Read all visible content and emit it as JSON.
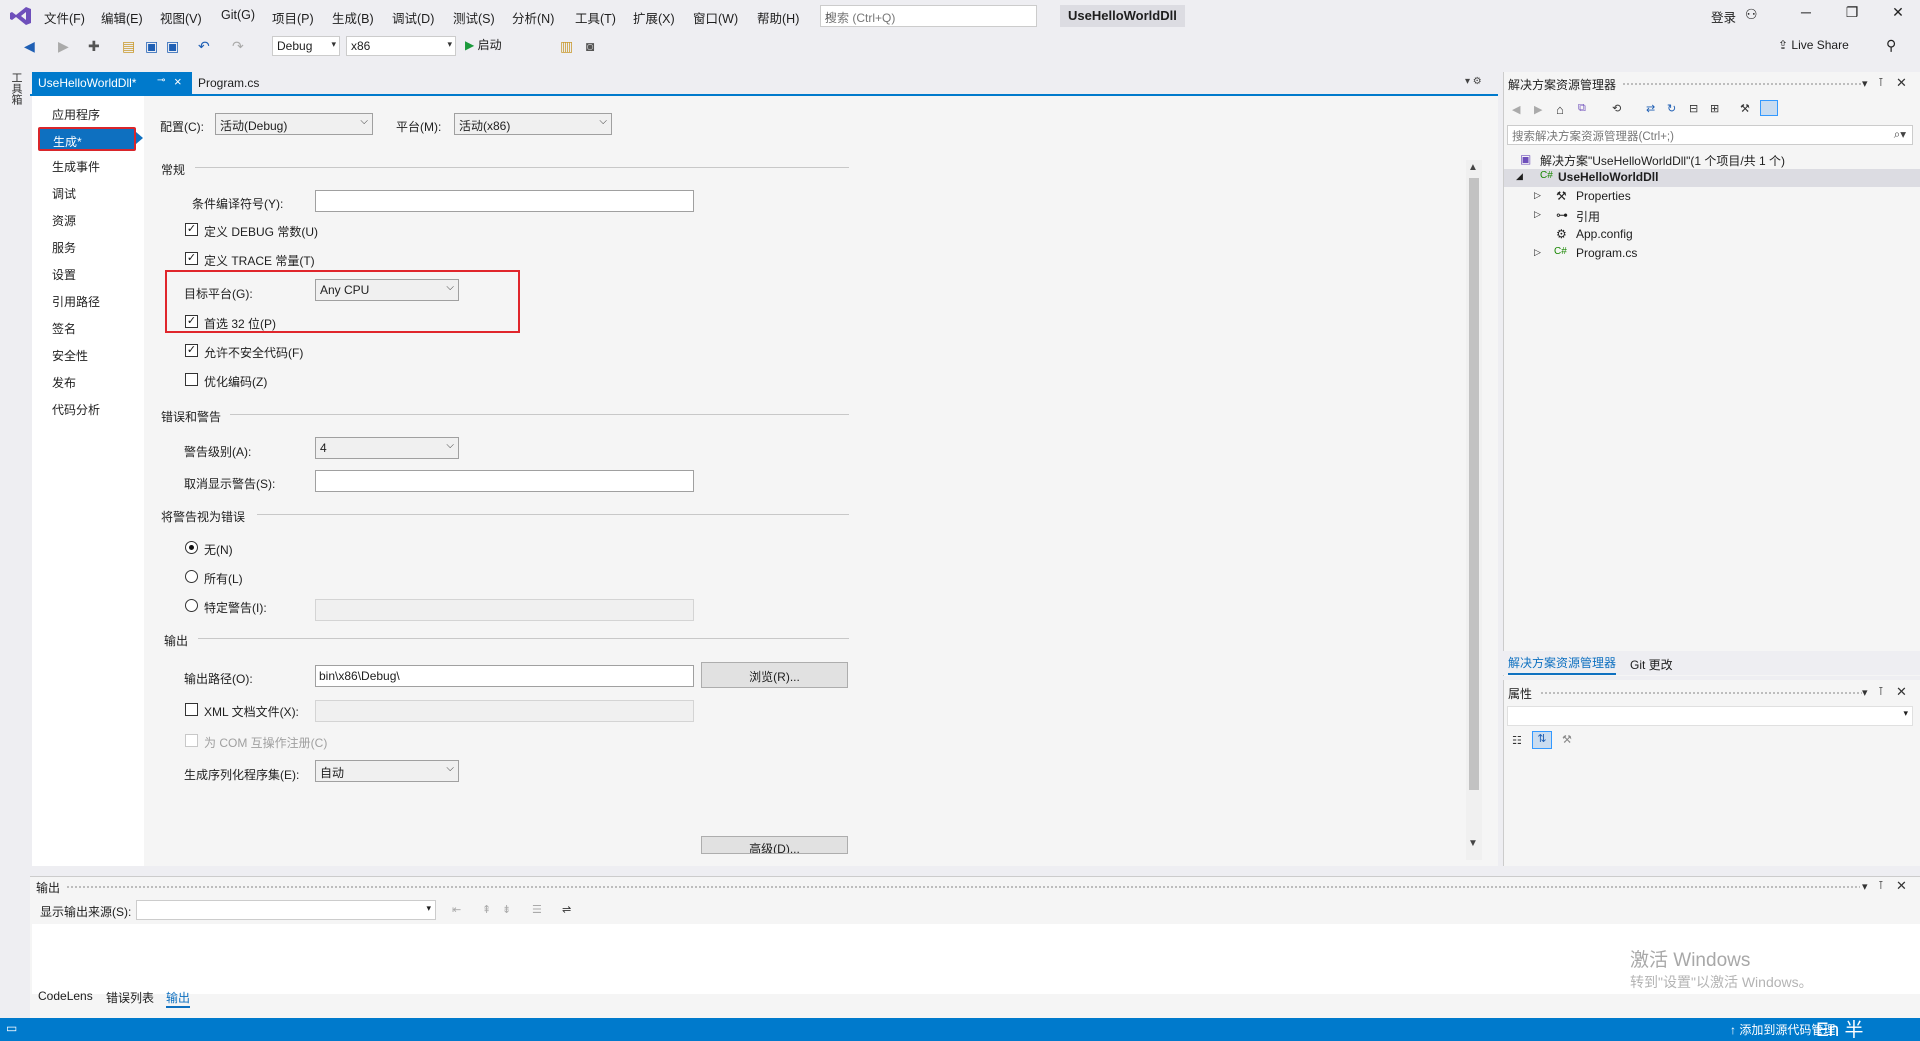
{
  "menu": {
    "items": [
      "文件(F)",
      "编辑(E)",
      "视图(V)",
      "Git(G)",
      "项目(P)",
      "生成(B)",
      "调试(D)",
      "测试(S)",
      "分析(N)",
      "工具(T)",
      "扩展(X)",
      "窗口(W)",
      "帮助(H)"
    ],
    "search_placeholder": "搜索 (Ctrl+Q)",
    "solution_title": "UseHelloWorldDll",
    "login": "登录"
  },
  "toolbar": {
    "config_value": "Debug",
    "platform_value": "x86",
    "start_label": "启动",
    "live_share_label": "Live Share"
  },
  "toolbox_label": "工具箱",
  "tabs": {
    "active": "UseHelloWorldDll*",
    "other": "Program.cs"
  },
  "nav": {
    "items": [
      "应用程序",
      "生成*",
      "生成事件",
      "调试",
      "资源",
      "服务",
      "设置",
      "引用路径",
      "签名",
      "安全性",
      "发布",
      "代码分析"
    ],
    "selected_index": 1
  },
  "form": {
    "config_label": "配置(C):",
    "config_value": "活动(Debug)",
    "platform_label": "平台(M):",
    "platform_value": "活动(x86)",
    "section_general": "常规",
    "cond_symbols_label": "条件编译符号(Y):",
    "cond_symbols_value": "",
    "define_debug_label": "定义 DEBUG 常数(U)",
    "define_debug_checked": true,
    "define_trace_label": "定义 TRACE 常量(T)",
    "define_trace_checked": true,
    "target_platform_label": "目标平台(G):",
    "target_platform_value": "Any CPU",
    "prefer32_label": "首选 32 位(P)",
    "prefer32_checked": true,
    "unsafe_label": "允许不安全代码(F)",
    "unsafe_checked": true,
    "optimize_label": "优化编码(Z)",
    "optimize_checked": false,
    "section_errors": "错误和警告",
    "warning_level_label": "警告级别(A):",
    "warning_level_value": "4",
    "suppress_label": "取消显示警告(S):",
    "suppress_value": "",
    "section_treat": "将警告视为错误",
    "radio_none": "无(N)",
    "radio_all": "所有(L)",
    "radio_specific": "特定警告(I):",
    "radio_selected": "none",
    "section_output": "输出",
    "output_path_label": "输出路径(O):",
    "output_path_value": "bin\\x86\\Debug\\",
    "browse_label": "浏览(R)...",
    "xml_doc_label": "XML 文档文件(X):",
    "xml_doc_checked": false,
    "com_label": "为 COM 互操作注册(C)",
    "com_checked": false,
    "serialization_label": "生成序列化程序集(E):",
    "serialization_value": "自动",
    "advanced_label": "高级(D)..."
  },
  "solution_explorer": {
    "title": "解决方案资源管理器",
    "search_placeholder": "搜索解决方案资源管理器(Ctrl+;)",
    "solution_node": "解决方案\"UseHelloWorldDll\"(1 个项目/共 1 个)",
    "project_node": "UseHelloWorldDll",
    "children": [
      "Properties",
      "引用",
      "App.config",
      "Program.cs"
    ],
    "tab_active": "解决方案资源管理器",
    "tab_git": "Git 更改"
  },
  "properties_panel": {
    "title": "属性"
  },
  "output_panel": {
    "title": "输出",
    "source_label": "显示输出来源(S):",
    "source_value": ""
  },
  "watermark": {
    "line1": "激活 Windows",
    "line2": "转到\"设置\"以激活 Windows。"
  },
  "bottom_tabs": [
    "CodeLens",
    "错误列表",
    "输出"
  ],
  "statusbar": {
    "add_source": "↑ 添加到源代码管理",
    "ime": "En 半"
  },
  "colors": {
    "accent": "#007acc",
    "nav_selected": "#0e70c0",
    "highlight": "#e0262c"
  }
}
